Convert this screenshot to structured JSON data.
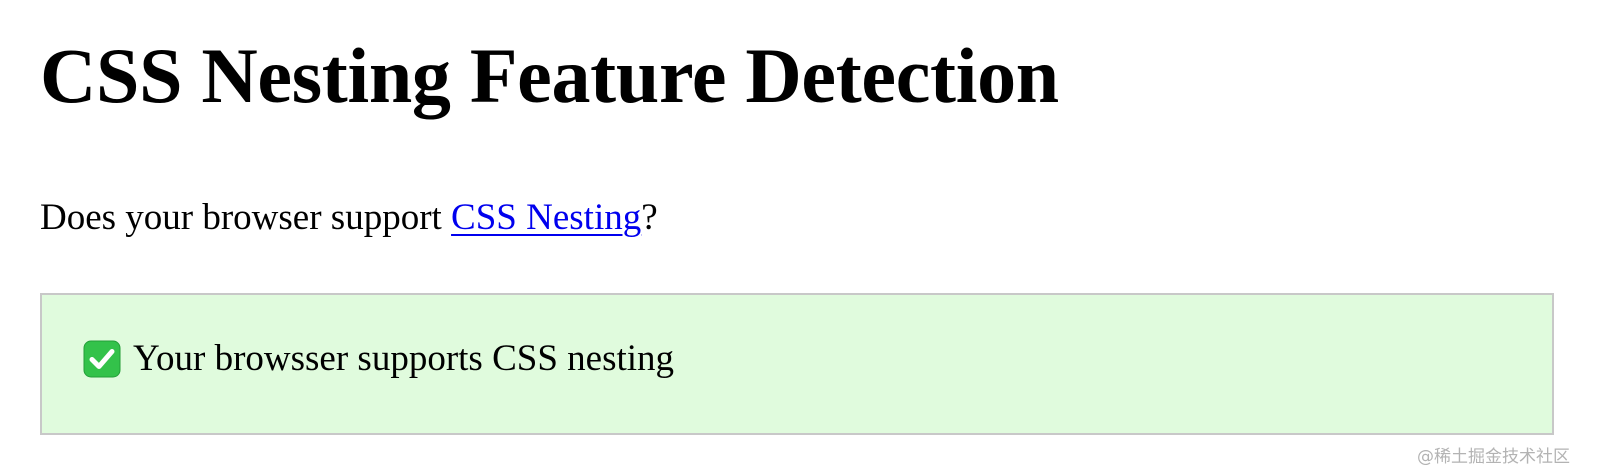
{
  "page": {
    "title": "CSS Nesting Feature Detection",
    "intro_before": "Does your browser support ",
    "intro_link": "CSS Nesting",
    "intro_after": "?"
  },
  "result": {
    "icon": "check-mark-icon",
    "message": "Your browsser supports CSS nesting",
    "status": "supported",
    "background_color": "#e0fbdd",
    "border_color": "#c8c8c8",
    "icon_color": "#33c24a"
  },
  "link_color": "#0000ee",
  "watermark": "@稀土掘金技术社区"
}
